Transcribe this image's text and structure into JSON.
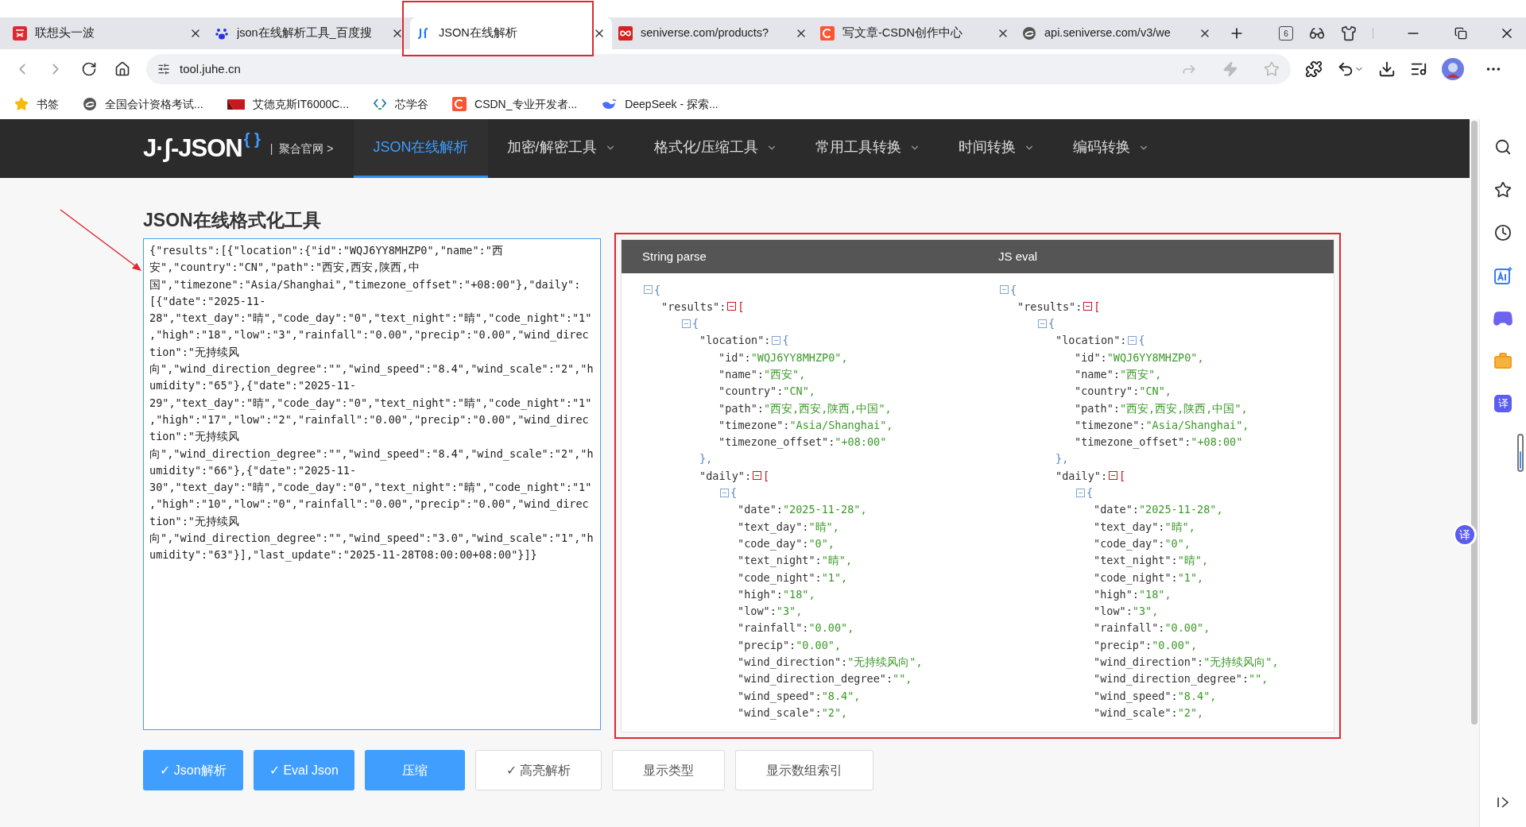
{
  "browser": {
    "tabs": [
      {
        "title": "联想头一波",
        "selected": false
      },
      {
        "title": "json在线解析工具_百度搜",
        "selected": false
      },
      {
        "title": "JSON在线解析",
        "selected": true
      },
      {
        "title": "seniverse.com/products?",
        "selected": false
      },
      {
        "title": "写文章-CSDN创作中心",
        "selected": false
      },
      {
        "title": "api.seniverse.com/v3/we",
        "selected": false
      }
    ],
    "tab_count": "6",
    "url": "tool.juhe.cn",
    "bookmarks": [
      "书签",
      "全国会计资格考试...",
      "艾德克斯IT6000C...",
      "芯学谷",
      "CSDN_专业开发者...",
      "DeepSeek - 探索..."
    ]
  },
  "site_nav": {
    "logo": "J·ʃ-JSON",
    "logo_mark": "{ }",
    "separator": "|",
    "home_link": "聚合官网 >",
    "items": [
      {
        "label": "JSON在线解析",
        "selected": true,
        "dropdown": false
      },
      {
        "label": "加密/解密工具",
        "selected": false,
        "dropdown": true
      },
      {
        "label": "格式化/压缩工具",
        "selected": false,
        "dropdown": true
      },
      {
        "label": "常用工具转换",
        "selected": false,
        "dropdown": true
      },
      {
        "label": "时间转换",
        "selected": false,
        "dropdown": true
      },
      {
        "label": "编码转换",
        "selected": false,
        "dropdown": true
      }
    ]
  },
  "page": {
    "title": "JSON在线格式化工具",
    "input": "{\"results\":[{\"location\":{\"id\":\"WQJ6YY8MHZP0\",\"name\":\"西安\",\"country\":\"CN\",\"path\":\"西安,西安,陕西,中国\",\"timezone\":\"Asia/Shanghai\",\"timezone_offset\":\"+08:00\"},\"daily\":[{\"date\":\"2025-11-28\",\"text_day\":\"晴\",\"code_day\":\"0\",\"text_night\":\"晴\",\"code_night\":\"1\",\"high\":\"18\",\"low\":\"3\",\"rainfall\":\"0.00\",\"precip\":\"0.00\",\"wind_direction\":\"无持续风向\",\"wind_direction_degree\":\"\",\"wind_speed\":\"8.4\",\"wind_scale\":\"2\",\"humidity\":\"65\"},{\"date\":\"2025-11-29\",\"text_day\":\"晴\",\"code_day\":\"0\",\"text_night\":\"晴\",\"code_night\":\"1\",\"high\":\"17\",\"low\":\"2\",\"rainfall\":\"0.00\",\"precip\":\"0.00\",\"wind_direction\":\"无持续风向\",\"wind_direction_degree\":\"\",\"wind_speed\":\"8.4\",\"wind_scale\":\"2\",\"humidity\":\"66\"},{\"date\":\"2025-11-30\",\"text_day\":\"晴\",\"code_day\":\"0\",\"text_night\":\"晴\",\"code_night\":\"1\",\"high\":\"10\",\"low\":\"0\",\"rainfall\":\"0.00\",\"precip\":\"0.00\",\"wind_direction\":\"无持续风向\",\"wind_direction_degree\":\"\",\"wind_speed\":\"3.0\",\"wind_scale\":\"1\",\"humidity\":\"63\"}],\"last_update\":\"2025-11-28T08:00:00+08:00\"}]}",
    "results_panel": {
      "columns": [
        {
          "heading": "String parse",
          "tree": {
            "kind": "object",
            "open": "{",
            "expanded": true,
            "children": [
              {
                "kind": "array",
                "key": "\"results\":",
                "open": "[",
                "expanded": true,
                "children": [
                  {
                    "kind": "object",
                    "open": "{",
                    "expanded": true,
                    "children": [
                      {
                        "kind": "object",
                        "key": "\"location\":",
                        "open": "{",
                        "close": "},",
                        "expanded": true,
                        "children": [
                          {
                            "kind": "value",
                            "key": "\"id\":",
                            "value": "\"WQJ6YY8MHZP0\","
                          },
                          {
                            "kind": "value",
                            "key": "\"name\":",
                            "value": "\"西安\","
                          },
                          {
                            "kind": "value",
                            "key": "\"country\":",
                            "value": "\"CN\","
                          },
                          {
                            "kind": "value",
                            "key": "\"path\":",
                            "value": "\"西安,西安,陕西,中国\","
                          },
                          {
                            "kind": "value",
                            "key": "\"timezone\":",
                            "value": "\"Asia/Shanghai\","
                          },
                          {
                            "kind": "value",
                            "key": "\"timezone_offset\":",
                            "value": "\"+08:00\""
                          }
                        ]
                      },
                      {
                        "kind": "array",
                        "key": "\"daily\":",
                        "open": "[",
                        "expanded": true,
                        "children": [
                          {
                            "kind": "object",
                            "open": "{",
                            "expanded": true,
                            "children": [
                              {
                                "kind": "value",
                                "key": "\"date\":",
                                "value": "\"2025-11-28\","
                              },
                              {
                                "kind": "value",
                                "key": "\"text_day\":",
                                "value": "\"晴\","
                              },
                              {
                                "kind": "value",
                                "key": "\"code_day\":",
                                "value": "\"0\","
                              },
                              {
                                "kind": "value",
                                "key": "\"text_night\":",
                                "value": "\"晴\","
                              },
                              {
                                "kind": "value",
                                "key": "\"code_night\":",
                                "value": "\"1\","
                              },
                              {
                                "kind": "value",
                                "key": "\"high\":",
                                "value": "\"18\","
                              },
                              {
                                "kind": "value",
                                "key": "\"low\":",
                                "value": "\"3\","
                              },
                              {
                                "kind": "value",
                                "key": "\"rainfall\":",
                                "value": "\"0.00\","
                              },
                              {
                                "kind": "value",
                                "key": "\"precip\":",
                                "value": "\"0.00\","
                              },
                              {
                                "kind": "value",
                                "key": "\"wind_direction\":",
                                "value": "\"无持续风向\","
                              },
                              {
                                "kind": "value",
                                "key": "\"wind_direction_degree\":",
                                "value": "\"\","
                              },
                              {
                                "kind": "value",
                                "key": "\"wind_speed\":",
                                "value": "\"8.4\","
                              },
                              {
                                "kind": "value",
                                "key": "\"wind_scale\":",
                                "value": "\"2\","
                              }
                            ]
                          }
                        ]
                      }
                    ]
                  }
                ]
              }
            ]
          }
        },
        {
          "heading": "JS eval",
          "tree": {
            "kind": "object",
            "open": "{",
            "expanded": true,
            "children": [
              {
                "kind": "array",
                "key": "\"results\":",
                "open": "[",
                "expanded": true,
                "children": [
                  {
                    "kind": "object",
                    "open": "{",
                    "expanded": true,
                    "children": [
                      {
                        "kind": "object",
                        "key": "\"location\":",
                        "open": "{",
                        "close": "},",
                        "expanded": true,
                        "children": [
                          {
                            "kind": "value",
                            "key": "\"id\":",
                            "value": "\"WQJ6YY8MHZP0\","
                          },
                          {
                            "kind": "value",
                            "key": "\"name\":",
                            "value": "\"西安\","
                          },
                          {
                            "kind": "value",
                            "key": "\"country\":",
                            "value": "\"CN\","
                          },
                          {
                            "kind": "value",
                            "key": "\"path\":",
                            "value": "\"西安,西安,陕西,中国\","
                          },
                          {
                            "kind": "value",
                            "key": "\"timezone\":",
                            "value": "\"Asia/Shanghai\","
                          },
                          {
                            "kind": "value",
                            "key": "\"timezone_offset\":",
                            "value": "\"+08:00\""
                          }
                        ]
                      },
                      {
                        "kind": "array",
                        "key": "\"daily\":",
                        "open": "[",
                        "expanded": true,
                        "children": [
                          {
                            "kind": "object",
                            "open": "{",
                            "expanded": true,
                            "children": [
                              {
                                "kind": "value",
                                "key": "\"date\":",
                                "value": "\"2025-11-28\","
                              },
                              {
                                "kind": "value",
                                "key": "\"text_day\":",
                                "value": "\"晴\","
                              },
                              {
                                "kind": "value",
                                "key": "\"code_day\":",
                                "value": "\"0\","
                              },
                              {
                                "kind": "value",
                                "key": "\"text_night\":",
                                "value": "\"晴\","
                              },
                              {
                                "kind": "value",
                                "key": "\"code_night\":",
                                "value": "\"1\","
                              },
                              {
                                "kind": "value",
                                "key": "\"high\":",
                                "value": "\"18\","
                              },
                              {
                                "kind": "value",
                                "key": "\"low\":",
                                "value": "\"3\","
                              },
                              {
                                "kind": "value",
                                "key": "\"rainfall\":",
                                "value": "\"0.00\","
                              },
                              {
                                "kind": "value",
                                "key": "\"precip\":",
                                "value": "\"0.00\","
                              },
                              {
                                "kind": "value",
                                "key": "\"wind_direction\":",
                                "value": "\"无持续风向\","
                              },
                              {
                                "kind": "value",
                                "key": "\"wind_direction_degree\":",
                                "value": "\"\","
                              },
                              {
                                "kind": "value",
                                "key": "\"wind_speed\":",
                                "value": "\"8.4\","
                              },
                              {
                                "kind": "value",
                                "key": "\"wind_scale\":",
                                "value": "\"2\","
                              }
                            ]
                          }
                        ]
                      }
                    ]
                  }
                ]
              }
            ]
          }
        }
      ]
    },
    "buttons": [
      {
        "label": "✓ Json解析",
        "kind": "primary"
      },
      {
        "label": "✓ Eval Json",
        "kind": "primary"
      },
      {
        "label": "压缩",
        "kind": "primary"
      },
      {
        "label": "✓ 高亮解析",
        "kind": "default"
      },
      {
        "label": "显示类型",
        "kind": "default"
      },
      {
        "label": "显示数组索引",
        "kind": "default"
      }
    ]
  },
  "sidebar": {
    "translate_label": "译"
  },
  "floating_translate": {
    "label": "译"
  },
  "annotations": [
    {
      "kind": "tab-box"
    },
    {
      "kind": "arrow"
    },
    {
      "kind": "panel-box"
    }
  ]
}
